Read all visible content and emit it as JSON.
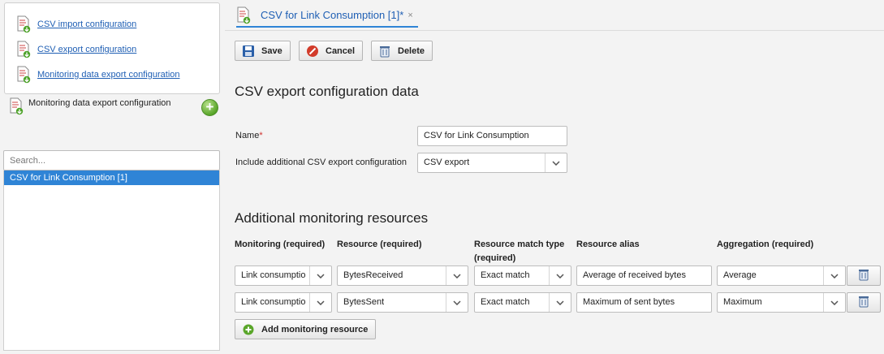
{
  "sidebar": {
    "links": [
      {
        "label": "CSV import configuration"
      },
      {
        "label": "CSV export configuration"
      },
      {
        "label": "Monitoring data export configuration"
      }
    ],
    "section_title": "Monitoring data export configuration",
    "search_placeholder": "Search...",
    "list_items": [
      "CSV for Link Consumption [1]"
    ]
  },
  "tab": {
    "label": "CSV for Link Consumption [1]*",
    "close": "×"
  },
  "toolbar": {
    "save": "Save",
    "cancel": "Cancel",
    "delete": "Delete"
  },
  "form": {
    "heading": "CSV export configuration data",
    "name_label": "Name",
    "required_mark": "*",
    "name_value": "CSV for Link Consumption",
    "include_label": "Include additional CSV export configuration",
    "include_value": "CSV export"
  },
  "resources": {
    "heading": "Additional monitoring resources",
    "columns": {
      "monitoring": "Monitoring (required)",
      "resource": "Resource (required)",
      "match_type_line1": "Resource match type",
      "match_type_line2": "(required)",
      "alias": "Resource alias",
      "aggregation": "Aggregation (required)"
    },
    "rows": [
      {
        "monitoring": "Link consumptio",
        "resource": "BytesReceived",
        "match": "Exact match",
        "alias": "Average of received bytes",
        "aggregation": "Average"
      },
      {
        "monitoring": "Link consumptio",
        "resource": "BytesSent",
        "match": "Exact match",
        "alias": "Maximum of sent bytes",
        "aggregation": "Maximum"
      }
    ],
    "add_button": "Add monitoring resource"
  },
  "colors": {
    "accent": "#2f84d6",
    "link": "#1f5fb4",
    "required": "#d0312d",
    "add_green": "#5aa62a"
  }
}
